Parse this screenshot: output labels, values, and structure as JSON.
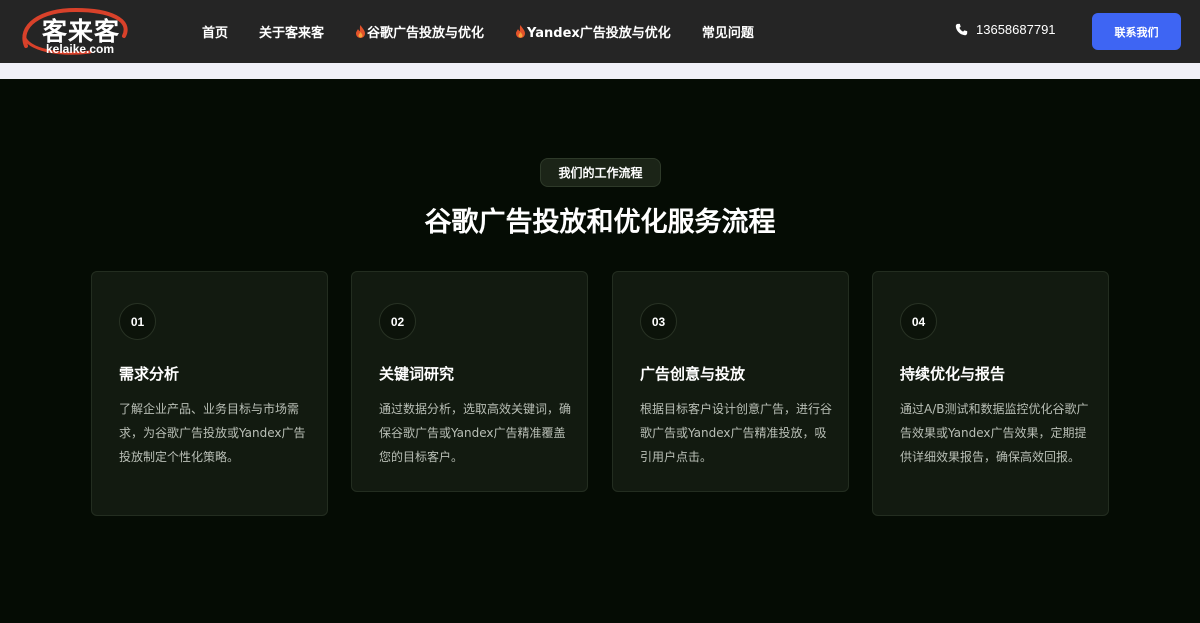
{
  "header": {
    "logo_cn": "客来客",
    "logo_en": "kelaike.com",
    "nav": [
      {
        "label": "首页",
        "hot": false
      },
      {
        "label": "关于客来客",
        "hot": false
      },
      {
        "label": "谷歌广告投放与优化",
        "hot": true
      },
      {
        "label": "Yandex广告投放与优化",
        "hot": true
      },
      {
        "label": "常见问题",
        "hot": false
      }
    ],
    "phone": "13658687791",
    "contact_label": "联系我们"
  },
  "section": {
    "badge": "我们的工作流程",
    "title": "谷歌广告投放和优化服务流程",
    "steps": [
      {
        "num": "01",
        "title": "需求分析",
        "desc": "了解企业产品、业务目标与市场需求，为谷歌广告投放或Yandex广告投放制定个性化策略。"
      },
      {
        "num": "02",
        "title": "关键词研究",
        "desc": "通过数据分析，选取高效关键词，确保谷歌广告或Yandex广告精准覆盖您的目标客户。"
      },
      {
        "num": "03",
        "title": "广告创意与投放",
        "desc": "根据目标客户设计创意广告，进行谷歌广告或Yandex广告精准投放，吸引用户点击。"
      },
      {
        "num": "04",
        "title": "持续优化与报告",
        "desc": "通过A/B测试和数据监控优化谷歌广告效果或Yandex广告效果，定期提供详细效果报告，确保高效回报。"
      }
    ]
  },
  "colors": {
    "header_bg": "#252525",
    "page_bg": "#050c04",
    "card_bg": "#121a10",
    "accent": "#3e65f3",
    "logo_ring": "#d8412a"
  }
}
